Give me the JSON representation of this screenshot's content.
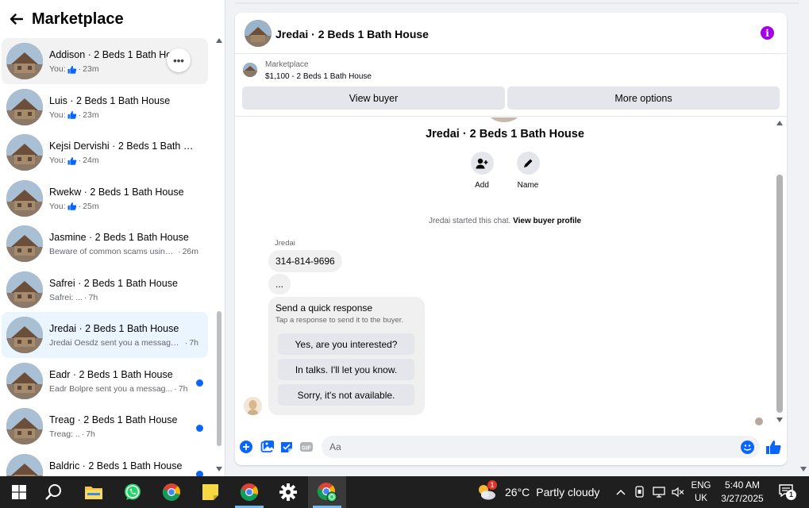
{
  "sidebar": {
    "title": "Marketplace",
    "conversations": [
      {
        "title": "Addison · 2 Beds 1 Bath House",
        "snippet": "You:",
        "has_like": true,
        "time": "23m",
        "unread": false,
        "state": "hover"
      },
      {
        "title": "Luis · 2 Beds 1 Bath House",
        "snippet": "You:",
        "has_like": true,
        "time": "23m",
        "unread": false,
        "state": ""
      },
      {
        "title": "Kejsi Dervishi · 2 Beds 1 Bath H...",
        "snippet": "You:",
        "has_like": true,
        "time": "24m",
        "unread": false,
        "state": ""
      },
      {
        "title": "Rwekw · 2 Beds 1 Bath House",
        "snippet": "You:",
        "has_like": true,
        "time": "25m",
        "unread": false,
        "state": ""
      },
      {
        "title": "Jasmine · 2 Beds 1 Bath House",
        "snippet": "Beware of common scams using ...",
        "has_like": false,
        "time": "26m",
        "unread": false,
        "state": ""
      },
      {
        "title": "Safrei · 2 Beds 1 Bath House",
        "snippet": "Safrei: ...",
        "has_like": false,
        "time": "7h",
        "unread": false,
        "state": ""
      },
      {
        "title": "Jredai · 2 Beds 1 Bath House",
        "snippet": "Jredai Oesdz sent you a message a...",
        "has_like": false,
        "time": "7h",
        "unread": false,
        "state": "active"
      },
      {
        "title": "Eadr · 2 Beds 1 Bath House",
        "snippet": "Eadr Bolpre sent you a messag...",
        "has_like": false,
        "time": "7h",
        "unread": true,
        "state": ""
      },
      {
        "title": "Treag · 2 Beds 1 Bath House",
        "snippet": "Treag: ..",
        "has_like": false,
        "time": "7h",
        "unread": true,
        "state": ""
      },
      {
        "title": "Baldric · 2 Beds 1 Bath House",
        "snippet": "",
        "has_like": false,
        "time": "",
        "unread": true,
        "state": ""
      }
    ],
    "more_glyph": "•••"
  },
  "chat": {
    "header_title": "Jredai · 2 Beds 1 Bath House",
    "info_glyph": "i",
    "listing_label": "Marketplace",
    "listing_price_title": "$1,100 - 2 Beds 1 Bath House",
    "view_buyer_label": "View buyer",
    "more_options_label": "More options",
    "conversation_name": "Jredai · 2 Beds 1 Bath House",
    "add_label": "Add",
    "name_label": "Name",
    "started_text": "Jredai started this chat.",
    "view_profile_link": "View buyer profile",
    "sender_name": "Jredai",
    "message_phone": "314-814-9696",
    "message_dots": "...",
    "quick_title": "Send a quick response",
    "quick_subtitle": "Tap a response to send it to the buyer.",
    "quick_responses": [
      "Yes, are you interested?",
      "In talks. I'll let you know.",
      "Sorry, it's not available."
    ],
    "composer_placeholder": "Aa"
  },
  "taskbar": {
    "apps": [
      "windows-start",
      "search",
      "file-explorer",
      "whatsapp",
      "chrome",
      "sticky-notes",
      "chrome",
      "settings",
      "chrome-active"
    ],
    "weather_badge": "1",
    "temperature": "26°C",
    "condition": "Partly cloudy",
    "lang_top": "ENG",
    "lang_bottom": "UK",
    "time": "5:40 AM",
    "date": "3/27/2025",
    "notification_count": "1"
  },
  "colors": {
    "accent": "#0866ff",
    "info": "#a200e6",
    "active_row": "#ebf5ff",
    "taskbar": "#1f1f1f"
  }
}
